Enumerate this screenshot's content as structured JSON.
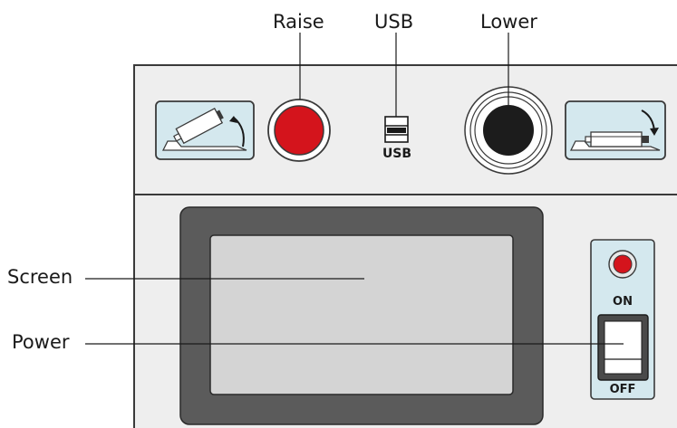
{
  "callouts": {
    "raise": "Raise",
    "usb": "USB",
    "lower": "Lower",
    "screen": "Screen",
    "power": "Power"
  },
  "panel": {
    "usb_label": "USB",
    "on_label": "ON",
    "off_label": "OFF"
  },
  "colors": {
    "panel": "#eeeeee",
    "outline": "#3a3a3a",
    "raise_button": "#d4141c",
    "lower_button": "#1c1c1c",
    "indicator": "#d4141c",
    "icon_box": "#d4e8ee",
    "screen_frame": "#5b5b5b",
    "screen": "#d4d4d4"
  },
  "icons": {
    "raise": "raise-arm-icon",
    "lower": "lower-arm-icon",
    "usb": "usb-port-icon"
  }
}
